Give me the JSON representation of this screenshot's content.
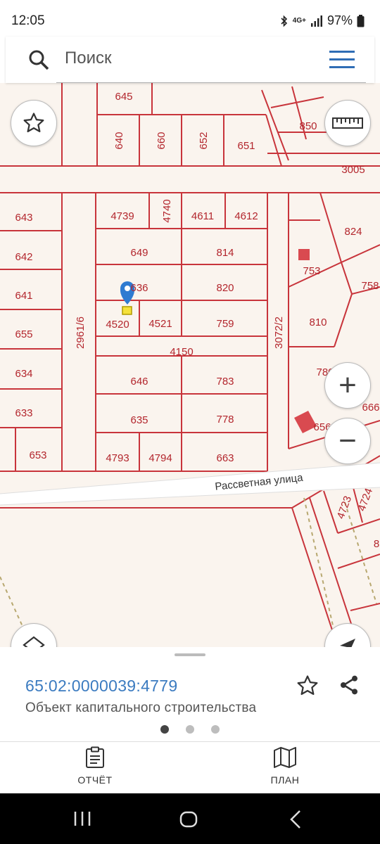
{
  "status_bar": {
    "time": "12:05",
    "network": "4G+",
    "battery": "97%"
  },
  "search": {
    "placeholder": "Поиск"
  },
  "map": {
    "street_name": "Рассветная улица",
    "parcels": [
      "645",
      "640",
      "660",
      "652",
      "651",
      "850",
      "3005",
      "643",
      "4739",
      "4740",
      "4611",
      "4612",
      "824",
      "642",
      "649",
      "814",
      "753",
      "641",
      "636",
      "820",
      "758",
      "655",
      "4520",
      "4521",
      "759",
      "810",
      "2961/6",
      "3072/2",
      "4150",
      "634",
      "646",
      "783",
      "780",
      "666",
      "633",
      "635",
      "778",
      "656",
      "653",
      "4793",
      "4794",
      "663",
      "4724",
      "4723",
      "8"
    ],
    "zoom_in_symbol": "+",
    "zoom_out_symbol": "−"
  },
  "sheet": {
    "cadastral_number": "65:02:0000039:4779",
    "object_type": "Объект капитального строительства",
    "page_count": 3,
    "active_page": 1
  },
  "bottom_nav": {
    "report_label": "ОТЧЁТ",
    "plan_label": "ПЛАН"
  },
  "colors": {
    "accent": "#2f6db5",
    "cadastral_text": "#3b7bc0",
    "parcel_line": "#c8343b",
    "parcel_label": "#b3262d",
    "map_bg": "#faf4ee",
    "marker": "#2f7bd1"
  }
}
